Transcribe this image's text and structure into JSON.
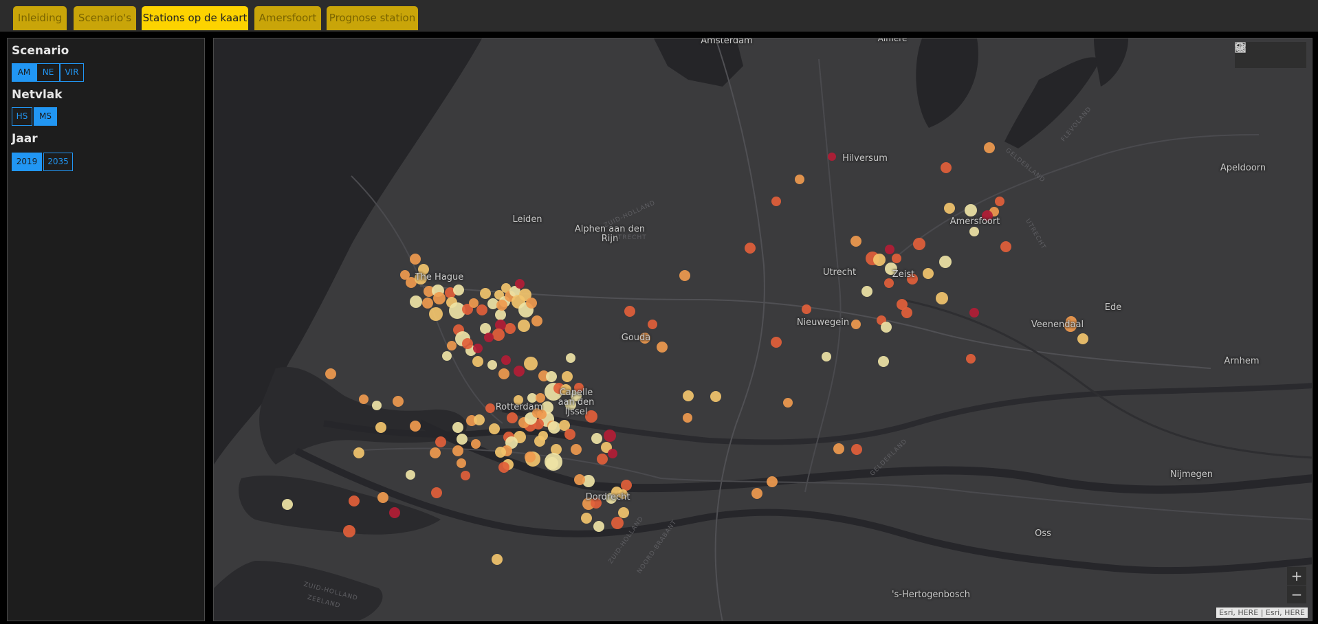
{
  "tabs": [
    {
      "label": "Inleiding",
      "active": false
    },
    {
      "label": "Scenario's",
      "active": false
    },
    {
      "label": "Stations op de kaart",
      "active": true
    },
    {
      "label": "Amersfoort",
      "active": false
    },
    {
      "label": "Prognose station",
      "active": false
    }
  ],
  "sidebar": {
    "scenario": {
      "title": "Scenario",
      "options": [
        "AM",
        "NE",
        "VIR"
      ],
      "selected": "AM"
    },
    "netvlak": {
      "title": "Netvlak",
      "options": [
        "HS",
        "MS"
      ],
      "selected": "MS"
    },
    "jaar": {
      "title": "Jaar",
      "options": [
        "2019",
        "2035"
      ],
      "selected": "2019"
    }
  },
  "map": {
    "places": [
      "Amsterdam",
      "Almere",
      "Hilversum",
      "Apeldoorn",
      "Amersfoort",
      "Leiden",
      "Alphen aan den Rijn",
      "The Hague",
      "Utrecht",
      "Zeist",
      "Nieuwegein",
      "Gouda",
      "Ede",
      "Veenendaal",
      "Arnhem",
      "Capelle aan den IJssel",
      "Rotterdam",
      "Dordrecht",
      "Nijmegen",
      "Oss",
      "'s-Hertogenbosch"
    ],
    "provinces": [
      "FLEVOLAND",
      "GELDERLAND",
      "ZUID-HOLLAND",
      "UTRECHT",
      "UTRECHT",
      "GELDERLAND",
      "ZUID-HOLLAND",
      "NOORD-BRABANT",
      "ZUID-HOLLAND",
      "ZEELAND"
    ],
    "attribution": "Esri, HERE | Esri, HERE",
    "zoom_in": "+",
    "zoom_out": "−",
    "tools": [
      "search-icon",
      "layers-icon",
      "basemap-gallery-icon"
    ],
    "station_colors": {
      "c1": "#eee3a5",
      "c2": "#f2c46d",
      "c3": "#ef9a4e",
      "c4": "#e2603a",
      "c5": "#b31d35"
    }
  }
}
